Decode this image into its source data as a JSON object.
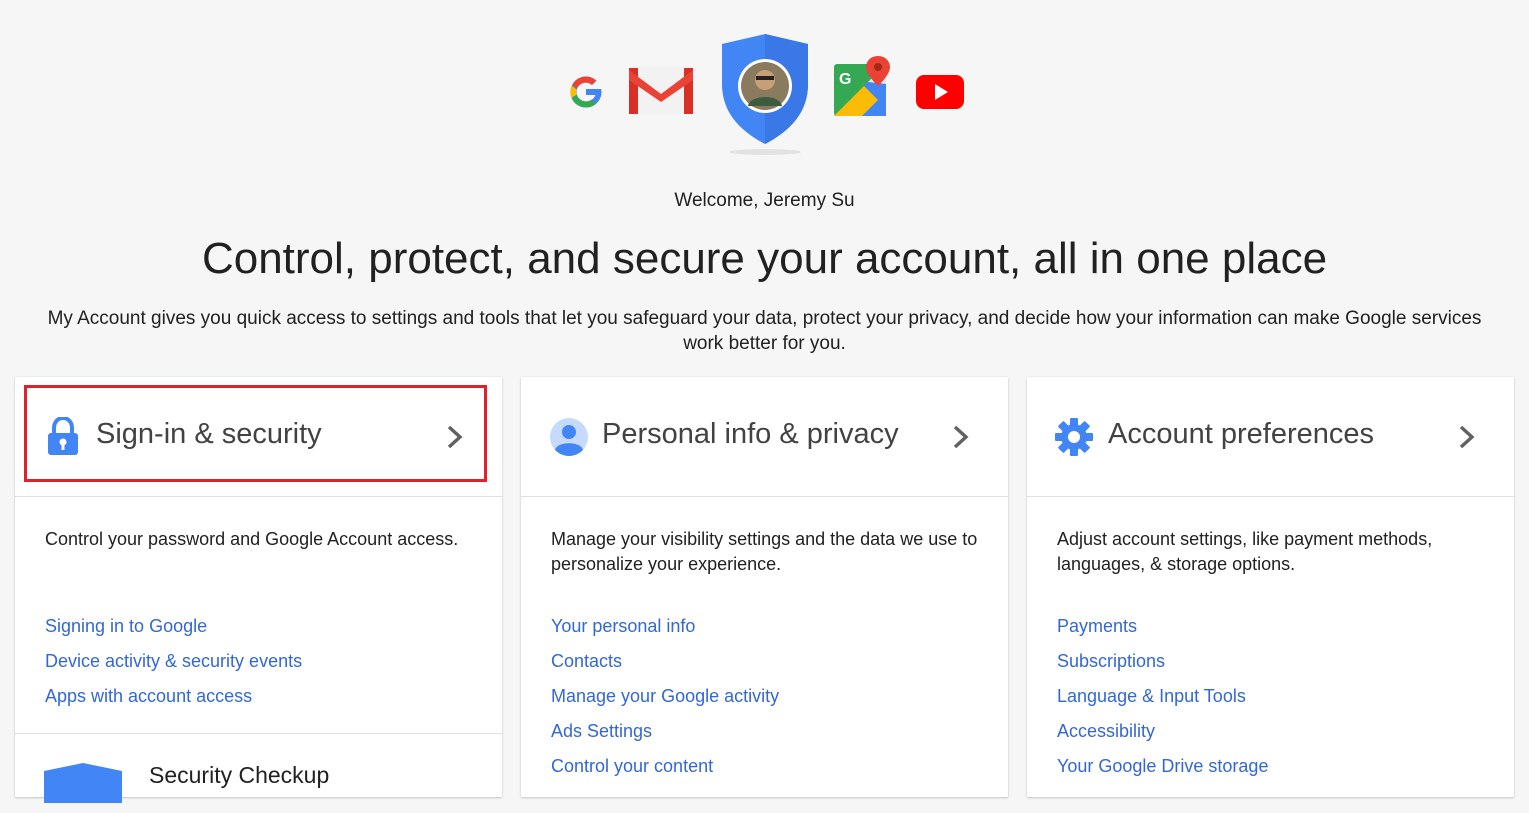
{
  "hero": {
    "logos": [
      "google-icon",
      "gmail-icon",
      "account-shield-avatar",
      "maps-icon",
      "youtube-icon"
    ],
    "welcome": "Welcome, Jeremy Su",
    "headline": "Control, protect, and secure your account, all in one place",
    "subline": "My Account gives you quick access to settings and tools that let you safeguard your data, protect your privacy, and decide how your information can make Google services work better for you."
  },
  "cards": [
    {
      "title": "Sign-in & security",
      "icon": "lock-icon",
      "description": "Control your password and Google Account access.",
      "links": [
        "Signing in to Google",
        "Device activity & security events",
        "Apps with account access"
      ],
      "checkup": "Security Checkup",
      "highlighted": true
    },
    {
      "title": "Personal info & privacy",
      "icon": "person-icon",
      "description": "Manage your visibility settings and the data we use to personalize your experience.",
      "links": [
        "Your personal info",
        "Contacts",
        "Manage your Google activity",
        "Ads Settings",
        "Control your content"
      ]
    },
    {
      "title": "Account preferences",
      "icon": "gear-icon",
      "description": "Adjust account settings, like payment methods, languages, & storage options.",
      "links": [
        "Payments",
        "Subscriptions",
        "Language & Input Tools",
        "Accessibility",
        "Your Google Drive storage"
      ]
    }
  ],
  "colors": {
    "background": "#f6f6f6",
    "link": "#3367d6",
    "google_blue": "#4285f4",
    "highlight_red": "#e0202b"
  }
}
